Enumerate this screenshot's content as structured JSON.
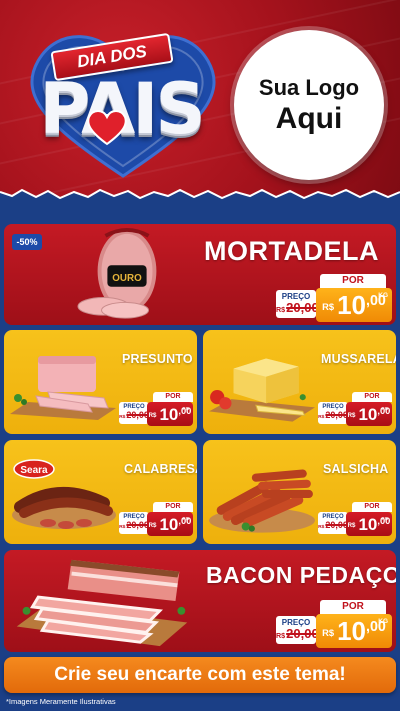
{
  "header": {
    "banner": "DIA DOS",
    "headline": "PAIS",
    "logo_line1": "Sua Logo",
    "logo_line2": "Aqui"
  },
  "featured_top": {
    "title": "MORTADELA",
    "discount": "-50%",
    "brand_label": "OURO",
    "tag": {
      "por": "POR",
      "preco_label": "PREÇO",
      "old_currency": "R$",
      "old_price": "20,00",
      "currency": "R$",
      "price_int": "10",
      "price_dec": ",00",
      "unit": "KG"
    }
  },
  "products": [
    {
      "title": "PRESUNTO",
      "tag": {
        "por": "POR",
        "preco_label": "PREÇO",
        "old_currency": "R$",
        "old_price": "20,00",
        "currency": "R$",
        "price_int": "10",
        "price_dec": ",00",
        "unit": "KG"
      }
    },
    {
      "title": "MUSSARELA",
      "tag": {
        "por": "POR",
        "preco_label": "PREÇO",
        "old_currency": "R$",
        "old_price": "20,00",
        "currency": "R$",
        "price_int": "10",
        "price_dec": ",00",
        "unit": "KG"
      }
    },
    {
      "title": "CALABRESA",
      "brand_label": "Seara",
      "tag": {
        "por": "POR",
        "preco_label": "PREÇO",
        "old_currency": "R$",
        "old_price": "20,00",
        "currency": "R$",
        "price_int": "10",
        "price_dec": ",00",
        "unit": "KG"
      }
    },
    {
      "title": "SALSICHA",
      "tag": {
        "por": "POR",
        "preco_label": "PREÇO",
        "old_currency": "R$",
        "old_price": "20,00",
        "currency": "R$",
        "price_int": "10",
        "price_dec": ",00",
        "unit": "KG"
      }
    }
  ],
  "featured_bottom": {
    "title": "BACON PEDAÇO",
    "tag": {
      "por": "POR",
      "preco_label": "PREÇO",
      "old_currency": "R$",
      "old_price": "20,00",
      "currency": "R$",
      "price_int": "10",
      "price_dec": ",00",
      "unit": "KG"
    }
  },
  "footer": {
    "cta": "Crie seu encarte com este tema!",
    "disclaimer": "*Imagens Meramente Ilustrativas"
  },
  "colors": {
    "red": "#c41a24",
    "yellow": "#f7c21b",
    "blue_bg": "#1b3f86",
    "orange": "#f08a05"
  }
}
